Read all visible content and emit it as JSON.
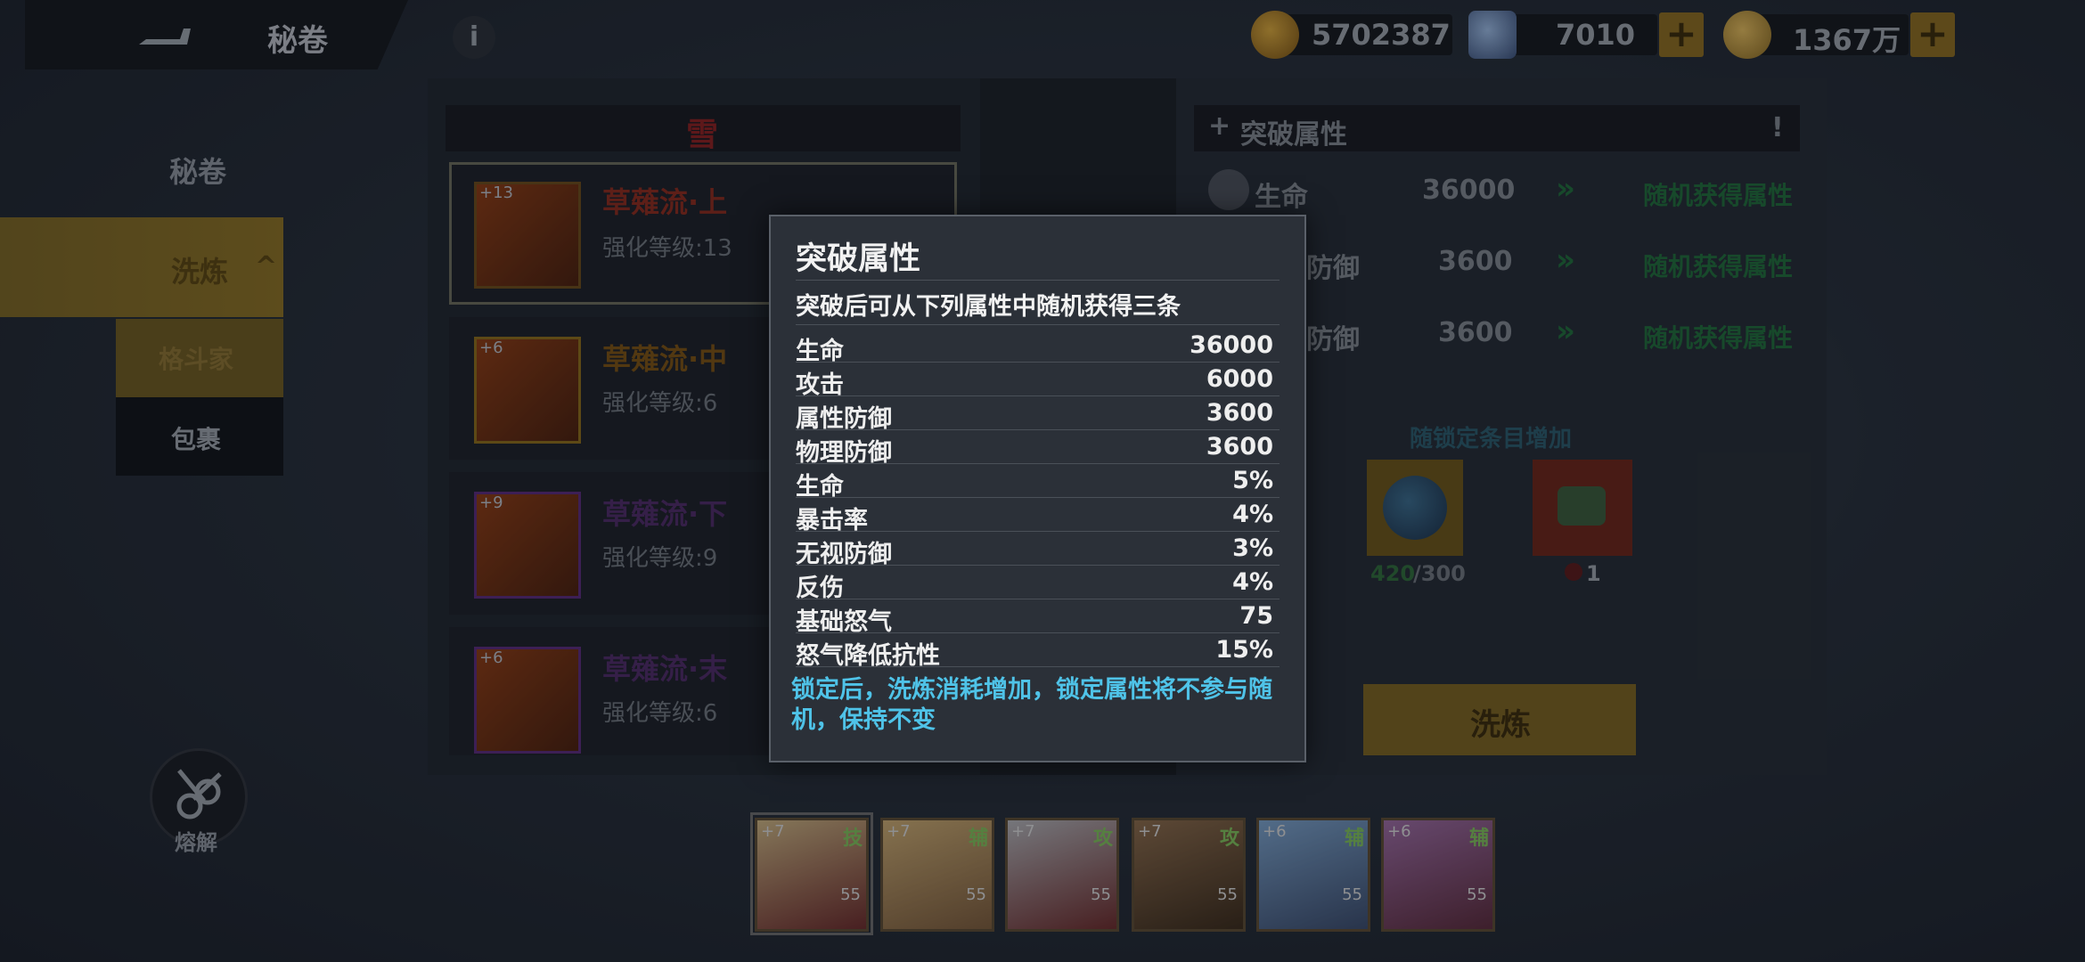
{
  "header": {
    "title": "秘卷",
    "resources": [
      {
        "icon": "gold-coin-icon",
        "value": "5702387"
      },
      {
        "icon": "diamond-icon",
        "value": "7010"
      },
      {
        "icon": "token-coin-icon",
        "value": "1367万"
      }
    ]
  },
  "sidebar": {
    "items": [
      {
        "label": "秘卷"
      },
      {
        "label": "洗炼"
      },
      {
        "label": "格斗家"
      },
      {
        "label": "包裹"
      }
    ],
    "melt_label": "熔解"
  },
  "list": {
    "header": "雪",
    "items": [
      {
        "plus": "+13",
        "name": "草薙流·上",
        "level": "强化等级:13",
        "color": "#a8402c"
      },
      {
        "plus": "+6",
        "name": "草薙流·中",
        "level": "强化等级:6",
        "color": "#a06a1a"
      },
      {
        "plus": "+9",
        "name": "草薙流·下",
        "level": "强化等级:9",
        "color": "#6a3a8a"
      },
      {
        "plus": "+6",
        "name": "草薙流·末",
        "level": "强化等级:6",
        "color": "#6a3a8a"
      }
    ]
  },
  "right": {
    "header": "突破属性",
    "rows": [
      {
        "name": "生命",
        "value": "36000",
        "result": "随机获得属性"
      },
      {
        "name": "防御",
        "value": "3600",
        "result": "随机获得属性"
      },
      {
        "name": "防御",
        "value": "3600",
        "result": "随机获得属性"
      }
    ],
    "lock_label": "随锁定条目增加",
    "cost_count": "420",
    "cost_total": "/300",
    "cost2_count": "1",
    "wash_button": "洗炼"
  },
  "tooltip": {
    "title": "突破属性",
    "subtitle": "突破后可从下列属性中随机获得三条",
    "rows": [
      {
        "name": "生命",
        "value": "36000"
      },
      {
        "name": "攻击",
        "value": "6000"
      },
      {
        "name": "属性防御",
        "value": "3600"
      },
      {
        "name": "物理防御",
        "value": "3600"
      },
      {
        "name": "生命",
        "value": "5%"
      },
      {
        "name": "暴击率",
        "value": "4%"
      },
      {
        "name": "无视防御",
        "value": "3%"
      },
      {
        "name": "反伤",
        "value": "4%"
      },
      {
        "name": "基础怒气",
        "value": "75"
      },
      {
        "name": "怒气降低抗性",
        "value": "15%"
      }
    ],
    "note": "锁定后，洗炼消耗增加，锁定属性将不参与随机，保持不变"
  },
  "heroes": [
    {
      "plus": "+7",
      "tag": "技",
      "level": "55"
    },
    {
      "plus": "+7",
      "tag": "辅",
      "level": "55"
    },
    {
      "plus": "+7",
      "tag": "攻",
      "level": "55"
    },
    {
      "plus": "+7",
      "tag": "攻",
      "level": "55"
    },
    {
      "plus": "+6",
      "tag": "辅",
      "level": "55"
    },
    {
      "plus": "+6",
      "tag": "辅",
      "level": "55"
    }
  ]
}
